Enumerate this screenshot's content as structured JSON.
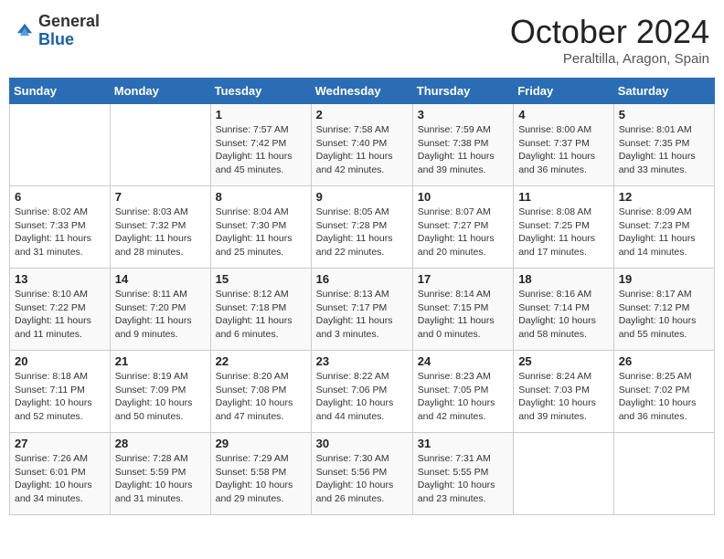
{
  "header": {
    "logo_general": "General",
    "logo_blue": "Blue",
    "month_title": "October 2024",
    "location": "Peraltilla, Aragon, Spain"
  },
  "days_of_week": [
    "Sunday",
    "Monday",
    "Tuesday",
    "Wednesday",
    "Thursday",
    "Friday",
    "Saturday"
  ],
  "weeks": [
    [
      {
        "day": "",
        "info": ""
      },
      {
        "day": "",
        "info": ""
      },
      {
        "day": "1",
        "info": "Sunrise: 7:57 AM\nSunset: 7:42 PM\nDaylight: 11 hours and 45 minutes."
      },
      {
        "day": "2",
        "info": "Sunrise: 7:58 AM\nSunset: 7:40 PM\nDaylight: 11 hours and 42 minutes."
      },
      {
        "day": "3",
        "info": "Sunrise: 7:59 AM\nSunset: 7:38 PM\nDaylight: 11 hours and 39 minutes."
      },
      {
        "day": "4",
        "info": "Sunrise: 8:00 AM\nSunset: 7:37 PM\nDaylight: 11 hours and 36 minutes."
      },
      {
        "day": "5",
        "info": "Sunrise: 8:01 AM\nSunset: 7:35 PM\nDaylight: 11 hours and 33 minutes."
      }
    ],
    [
      {
        "day": "6",
        "info": "Sunrise: 8:02 AM\nSunset: 7:33 PM\nDaylight: 11 hours and 31 minutes."
      },
      {
        "day": "7",
        "info": "Sunrise: 8:03 AM\nSunset: 7:32 PM\nDaylight: 11 hours and 28 minutes."
      },
      {
        "day": "8",
        "info": "Sunrise: 8:04 AM\nSunset: 7:30 PM\nDaylight: 11 hours and 25 minutes."
      },
      {
        "day": "9",
        "info": "Sunrise: 8:05 AM\nSunset: 7:28 PM\nDaylight: 11 hours and 22 minutes."
      },
      {
        "day": "10",
        "info": "Sunrise: 8:07 AM\nSunset: 7:27 PM\nDaylight: 11 hours and 20 minutes."
      },
      {
        "day": "11",
        "info": "Sunrise: 8:08 AM\nSunset: 7:25 PM\nDaylight: 11 hours and 17 minutes."
      },
      {
        "day": "12",
        "info": "Sunrise: 8:09 AM\nSunset: 7:23 PM\nDaylight: 11 hours and 14 minutes."
      }
    ],
    [
      {
        "day": "13",
        "info": "Sunrise: 8:10 AM\nSunset: 7:22 PM\nDaylight: 11 hours and 11 minutes."
      },
      {
        "day": "14",
        "info": "Sunrise: 8:11 AM\nSunset: 7:20 PM\nDaylight: 11 hours and 9 minutes."
      },
      {
        "day": "15",
        "info": "Sunrise: 8:12 AM\nSunset: 7:18 PM\nDaylight: 11 hours and 6 minutes."
      },
      {
        "day": "16",
        "info": "Sunrise: 8:13 AM\nSunset: 7:17 PM\nDaylight: 11 hours and 3 minutes."
      },
      {
        "day": "17",
        "info": "Sunrise: 8:14 AM\nSunset: 7:15 PM\nDaylight: 11 hours and 0 minutes."
      },
      {
        "day": "18",
        "info": "Sunrise: 8:16 AM\nSunset: 7:14 PM\nDaylight: 10 hours and 58 minutes."
      },
      {
        "day": "19",
        "info": "Sunrise: 8:17 AM\nSunset: 7:12 PM\nDaylight: 10 hours and 55 minutes."
      }
    ],
    [
      {
        "day": "20",
        "info": "Sunrise: 8:18 AM\nSunset: 7:11 PM\nDaylight: 10 hours and 52 minutes."
      },
      {
        "day": "21",
        "info": "Sunrise: 8:19 AM\nSunset: 7:09 PM\nDaylight: 10 hours and 50 minutes."
      },
      {
        "day": "22",
        "info": "Sunrise: 8:20 AM\nSunset: 7:08 PM\nDaylight: 10 hours and 47 minutes."
      },
      {
        "day": "23",
        "info": "Sunrise: 8:22 AM\nSunset: 7:06 PM\nDaylight: 10 hours and 44 minutes."
      },
      {
        "day": "24",
        "info": "Sunrise: 8:23 AM\nSunset: 7:05 PM\nDaylight: 10 hours and 42 minutes."
      },
      {
        "day": "25",
        "info": "Sunrise: 8:24 AM\nSunset: 7:03 PM\nDaylight: 10 hours and 39 minutes."
      },
      {
        "day": "26",
        "info": "Sunrise: 8:25 AM\nSunset: 7:02 PM\nDaylight: 10 hours and 36 minutes."
      }
    ],
    [
      {
        "day": "27",
        "info": "Sunrise: 7:26 AM\nSunset: 6:01 PM\nDaylight: 10 hours and 34 minutes."
      },
      {
        "day": "28",
        "info": "Sunrise: 7:28 AM\nSunset: 5:59 PM\nDaylight: 10 hours and 31 minutes."
      },
      {
        "day": "29",
        "info": "Sunrise: 7:29 AM\nSunset: 5:58 PM\nDaylight: 10 hours and 29 minutes."
      },
      {
        "day": "30",
        "info": "Sunrise: 7:30 AM\nSunset: 5:56 PM\nDaylight: 10 hours and 26 minutes."
      },
      {
        "day": "31",
        "info": "Sunrise: 7:31 AM\nSunset: 5:55 PM\nDaylight: 10 hours and 23 minutes."
      },
      {
        "day": "",
        "info": ""
      },
      {
        "day": "",
        "info": ""
      }
    ]
  ]
}
